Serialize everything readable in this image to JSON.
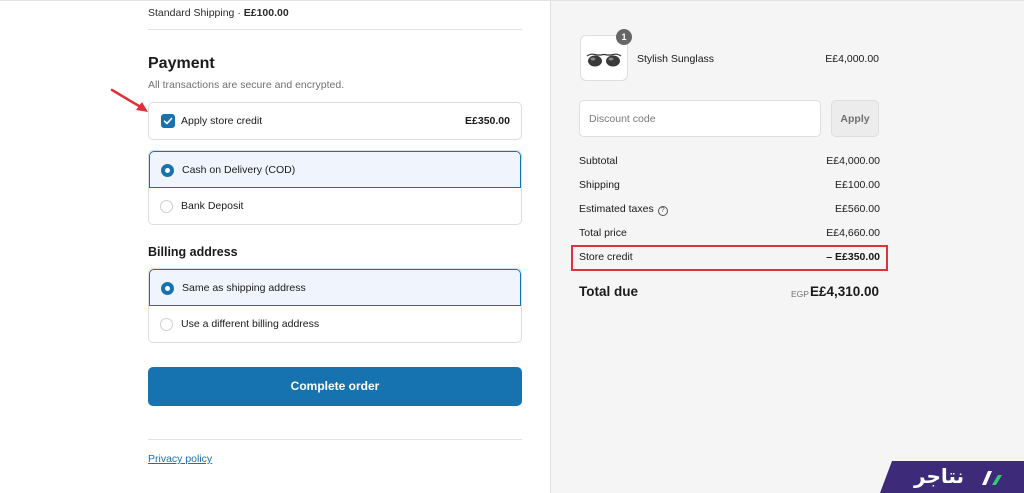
{
  "shipping": {
    "method": "Standard Shipping",
    "separator": "·",
    "price": "E£100.00"
  },
  "payment": {
    "title": "Payment",
    "subtitle": "All transactions are secure and encrypted.",
    "store_credit": {
      "label": "Apply store credit",
      "amount": "E£350.00",
      "checked": true
    },
    "options": [
      {
        "label": "Cash on Delivery (COD)",
        "selected": true
      },
      {
        "label": "Bank Deposit",
        "selected": false
      }
    ]
  },
  "billing": {
    "title": "Billing address",
    "options": [
      {
        "label": "Same as shipping address",
        "selected": true
      },
      {
        "label": "Use a different billing address",
        "selected": false
      }
    ]
  },
  "complete_button": "Complete order",
  "privacy_link": "Privacy policy",
  "order": {
    "product": {
      "name": "Stylish Sunglass",
      "price": "E£4,000.00",
      "quantity": "1"
    },
    "discount_placeholder": "Discount code",
    "apply_label": "Apply",
    "summary": [
      {
        "label": "Subtotal",
        "value": "E£4,000.00"
      },
      {
        "label": "Shipping",
        "value": "E£100.00"
      },
      {
        "label": "Estimated taxes",
        "value": "E£560.00"
      },
      {
        "label": "Total price",
        "value": "E£4,660.00"
      }
    ],
    "store_credit_row": {
      "label": "Store credit",
      "value": "– E£350.00"
    },
    "total": {
      "label": "Total due",
      "currency": "EGP",
      "value": "E£4,310.00"
    }
  },
  "brand": {
    "name": "نتاجر"
  },
  "colors": {
    "accent": "#1773b0",
    "highlight": "#e0303a",
    "brand": "#3d2b7a",
    "summary_bg": "#f5f5f5"
  }
}
